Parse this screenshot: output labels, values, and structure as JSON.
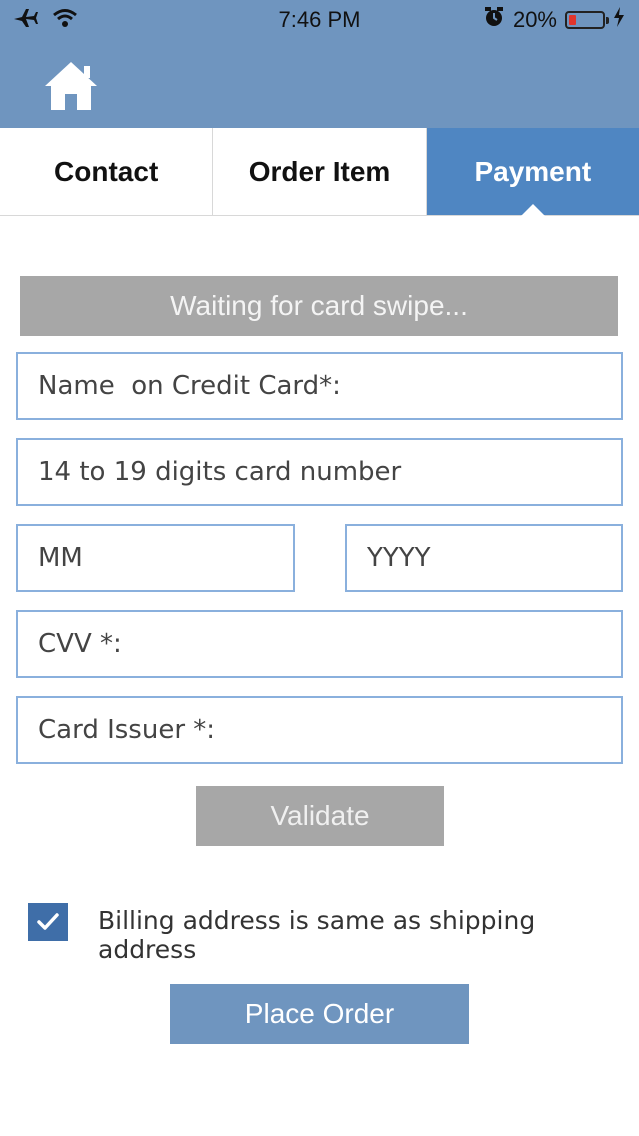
{
  "status_bar": {
    "time": "7:46 PM",
    "battery_text": "20%",
    "battery_level": 0.2,
    "icons": [
      "airplane-icon",
      "wifi-icon",
      "alarm-icon",
      "battery-icon",
      "charging-icon"
    ]
  },
  "nav": {
    "home_icon": "home-icon"
  },
  "tabs": [
    {
      "label": "Contact",
      "active": false
    },
    {
      "label": "Order Item",
      "active": false
    },
    {
      "label": "Payment",
      "active": true
    }
  ],
  "payment": {
    "swipe_status": "Waiting for card swipe...",
    "fields": {
      "name_on_card": {
        "placeholder": "Name  on Credit Card*:",
        "value": ""
      },
      "card_number": {
        "placeholder": "14 to 19 digits card number",
        "value": ""
      },
      "exp_month": {
        "placeholder": "MM",
        "value": ""
      },
      "exp_year": {
        "placeholder": "YYYY",
        "value": ""
      },
      "cvv": {
        "placeholder": "CVV *:",
        "value": ""
      },
      "card_issuer": {
        "placeholder": "Card Issuer *:",
        "value": ""
      }
    },
    "validate_label": "Validate",
    "billing_same": {
      "checked": true,
      "label": "Billing address is same as shipping address"
    },
    "place_order_label": "Place Order"
  },
  "colors": {
    "header": "#6f95bf",
    "active_tab": "#4f86c2",
    "field_border": "#8ab0dd",
    "gray_button": "#a7a7a7",
    "checkbox": "#3f6ea8",
    "battery_low": "#e0352b"
  }
}
